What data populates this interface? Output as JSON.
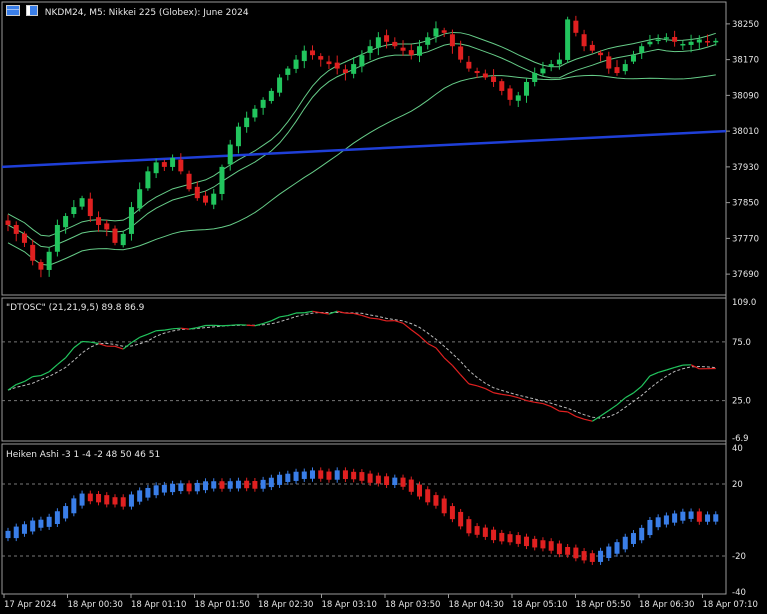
{
  "header": {
    "symbol_text": "NKDM24, M5:  Nikkei 225 (Globex): June 2024"
  },
  "main_pane": {
    "price_axis": [
      "38250",
      "38170",
      "38090",
      "38010",
      "37930",
      "37850",
      "37770",
      "37690"
    ]
  },
  "osc_pane": {
    "title": "\"DTOSC\" (21,21,9,5) 89.8 86.9",
    "axis": [
      "109.0",
      "75.0",
      "25.0",
      "-6.9"
    ]
  },
  "ha_pane": {
    "title": "Heiken Ashi -3 1 -4 -2 48 50 46 51",
    "axis": [
      "40",
      "20",
      "-20",
      "-40"
    ]
  },
  "time_axis": [
    "17 Apr 2024",
    "18 Apr 00:30",
    "18 Apr 01:10",
    "18 Apr 01:50",
    "18 Apr 02:30",
    "18 Apr 03:10",
    "18 Apr 03:50",
    "18 Apr 04:30",
    "18 Apr 05:10",
    "18 Apr 05:50",
    "18 Apr 06:30",
    "18 Apr 07:10"
  ],
  "colors": {
    "bull": "#22c55e",
    "bear": "#e02020",
    "ma_long": "#1f3fd8",
    "band": "#66cc88",
    "ha_up": "#3a7ee8",
    "ha_down": "#e02020",
    "grid": "#777777"
  },
  "chart_data": {
    "type": "candlestick",
    "x_range": [
      "17 Apr 2024",
      "18 Apr 07:10"
    ],
    "ylim": [
      37650,
      38290
    ],
    "close": [
      37800,
      37780,
      37760,
      37720,
      37700,
      37740,
      37800,
      37820,
      37840,
      37860,
      37820,
      37800,
      37790,
      37760,
      37780,
      37840,
      37880,
      37920,
      37940,
      37930,
      37950,
      37920,
      37880,
      37860,
      37850,
      37870,
      37930,
      37980,
      38020,
      38040,
      38060,
      38080,
      38100,
      38130,
      38150,
      38170,
      38190,
      38180,
      38170,
      38160,
      38150,
      38140,
      38160,
      38180,
      38200,
      38220,
      38210,
      38200,
      38190,
      38180,
      38200,
      38220,
      38240,
      38230,
      38200,
      38170,
      38150,
      38140,
      38130,
      38120,
      38100,
      38080,
      38090,
      38120,
      38140,
      38150,
      38160,
      38170,
      38260,
      38230,
      38200,
      38190,
      38180,
      38150,
      38140,
      38160,
      38180,
      38200,
      38210,
      38215,
      38220,
      38210,
      38205,
      38210,
      38215,
      38210,
      38212
    ],
    "sma_long": {
      "x_range": [
        "17 Apr 2024",
        "18 Apr 07:10"
      ],
      "y_start": 37930,
      "y_end": 38010
    },
    "oscillator": {
      "range": [
        -6.9,
        109.0
      ],
      "levels": [
        75.0,
        25.0
      ],
      "last": [
        89.8,
        86.9
      ]
    },
    "heiken_ashi_osc": {
      "range": [
        -40,
        40
      ],
      "levels": [
        20,
        -20
      ]
    }
  }
}
